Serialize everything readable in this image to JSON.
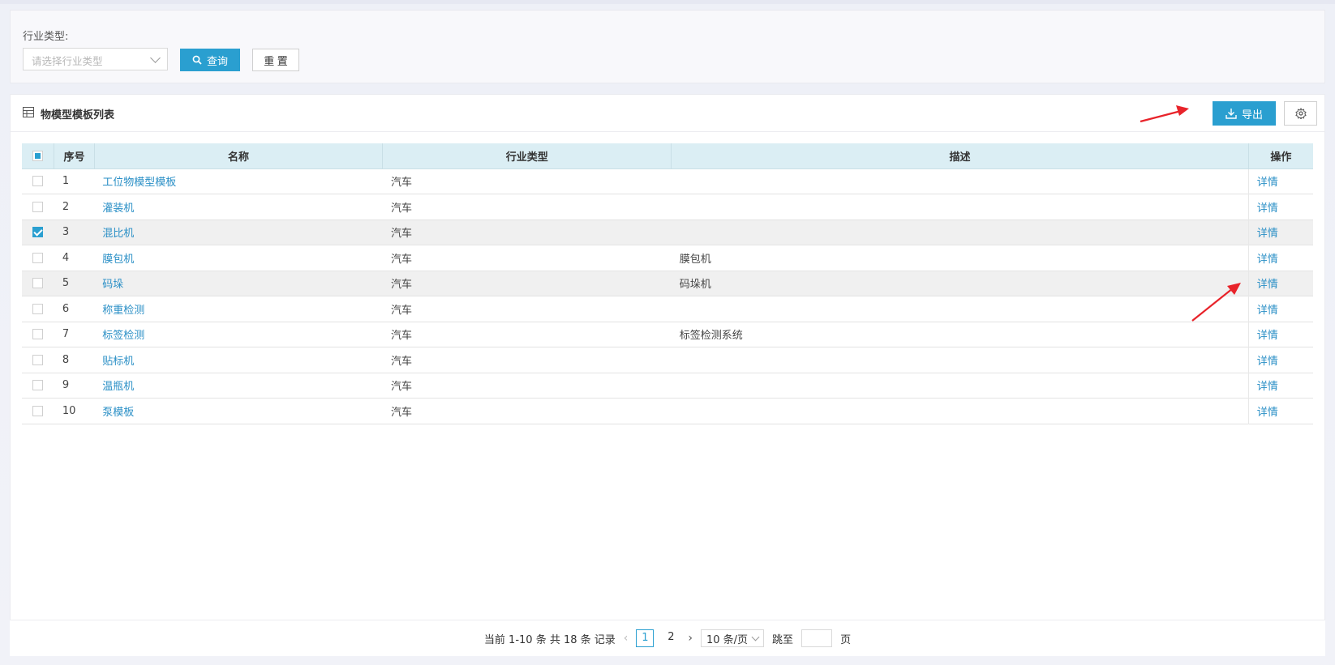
{
  "filter": {
    "label": "行业类型:",
    "select_placeholder": "请选择行业类型",
    "query_button": "查询",
    "reset_button": "重 置"
  },
  "panel": {
    "title": "物模型模板列表",
    "export_button": "导出"
  },
  "table": {
    "headers": {
      "index": "序号",
      "name": "名称",
      "industry": "行业类型",
      "desc": "描述",
      "action": "操作"
    },
    "rows": [
      {
        "index": "1",
        "name": "工位物模型模板",
        "industry": "汽车",
        "desc": "",
        "action": "详情",
        "checked": false
      },
      {
        "index": "2",
        "name": "灌装机",
        "industry": "汽车",
        "desc": "",
        "action": "详情",
        "checked": false
      },
      {
        "index": "3",
        "name": "混比机",
        "industry": "汽车",
        "desc": "",
        "action": "详情",
        "checked": true
      },
      {
        "index": "4",
        "name": "膜包机",
        "industry": "汽车",
        "desc": "膜包机",
        "action": "详情",
        "checked": false
      },
      {
        "index": "5",
        "name": "码垛",
        "industry": "汽车",
        "desc": "码垛机",
        "action": "详情",
        "checked": false
      },
      {
        "index": "6",
        "name": "称重检测",
        "industry": "汽车",
        "desc": "",
        "action": "详情",
        "checked": false
      },
      {
        "index": "7",
        "name": "标签检测",
        "industry": "汽车",
        "desc": "标签检测系统",
        "action": "详情",
        "checked": false
      },
      {
        "index": "8",
        "name": "贴标机",
        "industry": "汽车",
        "desc": "",
        "action": "详情",
        "checked": false
      },
      {
        "index": "9",
        "name": "温瓶机",
        "industry": "汽车",
        "desc": "",
        "action": "详情",
        "checked": false
      },
      {
        "index": "10",
        "name": "泵模板",
        "industry": "汽车",
        "desc": "",
        "action": "详情",
        "checked": false
      }
    ]
  },
  "pagination": {
    "summary": "当前 1-10 条 共 18 条 记录",
    "pages": [
      "1",
      "2"
    ],
    "current_page": "1",
    "page_size": "10 条/页",
    "jump_label": "跳至",
    "page_suffix": "页"
  },
  "colors": {
    "accent": "#2a9fd0",
    "link": "#2a8fc6",
    "annotation_arrow": "#e8232a"
  }
}
